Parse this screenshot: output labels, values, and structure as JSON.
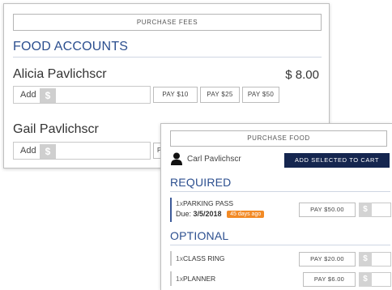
{
  "fees_card": {
    "purchase_button": "PURCHASE FEES",
    "section_title": "FOOD ACCOUNTS",
    "accounts": [
      {
        "name": "Alicia Pavlichscr",
        "balance": "$ 8.00",
        "add_label": "Add",
        "currency_symbol": "$",
        "pay_options": [
          "PAY $10",
          "PAY $25",
          "PAY $50"
        ]
      },
      {
        "name": "Gail Pavlichscr",
        "add_label": "Add",
        "currency_symbol": "$",
        "pay_options": [
          "P"
        ]
      }
    ]
  },
  "food_card": {
    "purchase_button": "PURCHASE FOOD",
    "student_name": "Carl Pavlichscr",
    "add_to_cart_button": "ADD SELECTED TO CART",
    "required_title": "REQUIRED",
    "optional_title": "OPTIONAL",
    "currency_symbol": "$",
    "required_items": [
      {
        "qty": "1x",
        "name": "PARKING PASS",
        "due_label": "Due:",
        "due_date": "3/5/2018",
        "overdue_badge": "45 days ago",
        "pay_label": "PAY $50.00"
      }
    ],
    "optional_items": [
      {
        "qty": "1x",
        "name": "CLASS RING",
        "pay_label": "PAY $20.00"
      },
      {
        "qty": "1x",
        "name": "PLANNER",
        "pay_label": "PAY $6.00"
      }
    ]
  },
  "colors": {
    "accent": "#2c4f8f",
    "cart_button": "#15264f",
    "overdue_badge": "#f28a26"
  }
}
